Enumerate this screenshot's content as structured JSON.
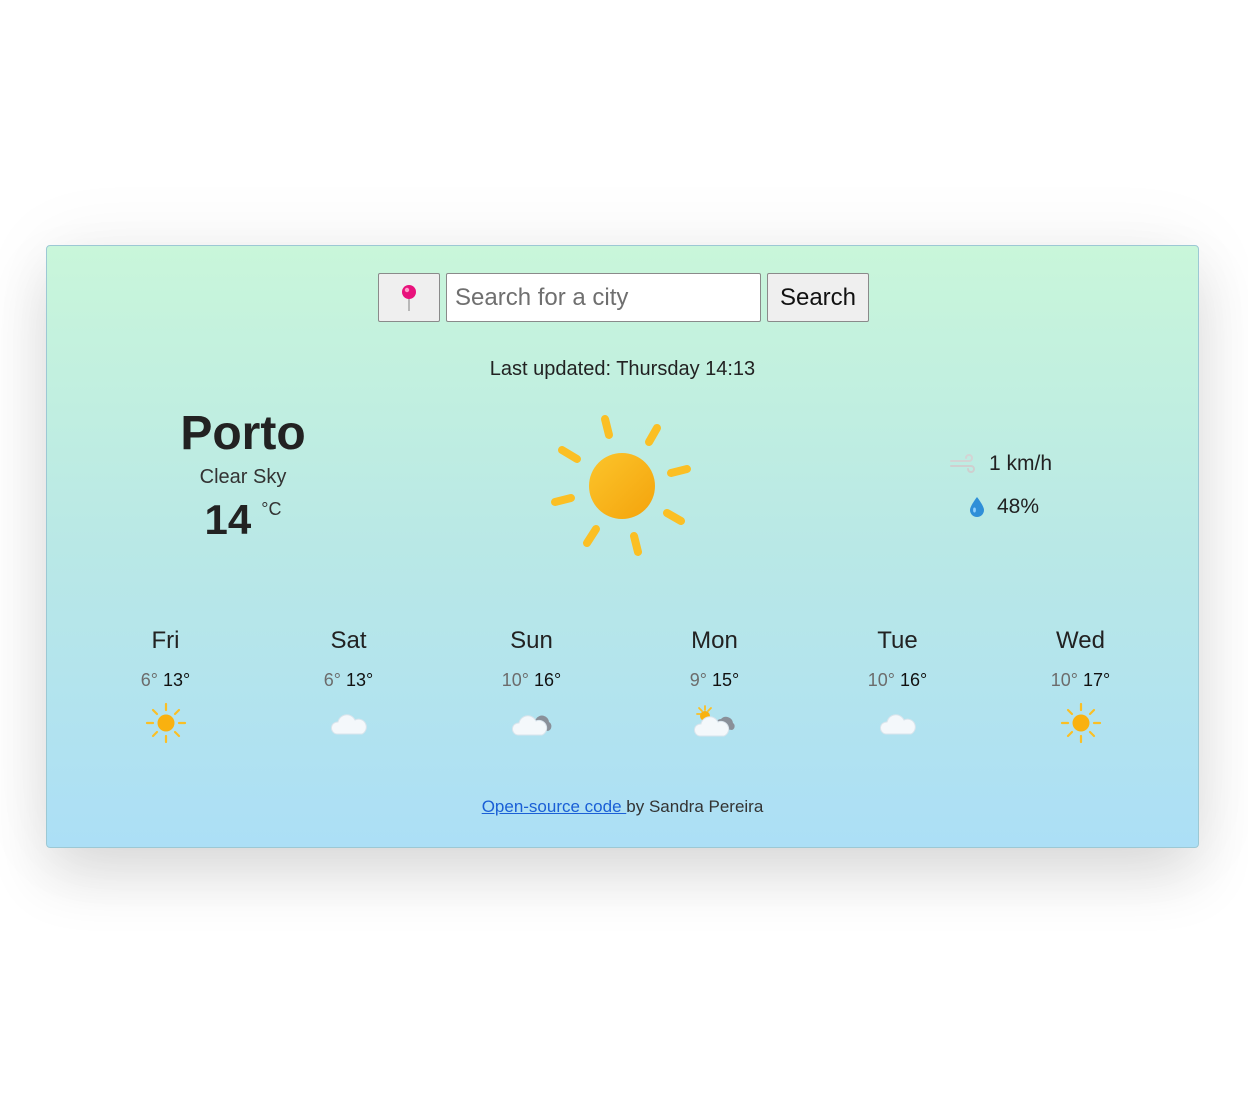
{
  "search": {
    "placeholder": "Search for a city",
    "button_label": "Search",
    "location_icon": "pushpin-icon"
  },
  "current": {
    "last_updated": "Last updated: Thursday 14:13",
    "city": "Porto",
    "condition": "Clear Sky",
    "temperature": "14",
    "unit": "°C",
    "icon": "sun-icon",
    "wind": "1 km/h",
    "wind_icon": "wind-icon",
    "humidity": "48%",
    "humidity_icon": "water-drop-icon"
  },
  "forecast": [
    {
      "day": "Fri",
      "min": "6°",
      "max": "13°",
      "icon": "sun-icon"
    },
    {
      "day": "Sat",
      "min": "6°",
      "max": "13°",
      "icon": "cloud-icon"
    },
    {
      "day": "Sun",
      "min": "10°",
      "max": "16°",
      "icon": "cloudy-icon"
    },
    {
      "day": "Mon",
      "min": "9°",
      "max": "15°",
      "icon": "partly-cloudy-icon"
    },
    {
      "day": "Tue",
      "min": "10°",
      "max": "16°",
      "icon": "cloud-icon"
    },
    {
      "day": "Wed",
      "min": "10°",
      "max": "17°",
      "icon": "sun-icon"
    }
  ],
  "footer": {
    "link_text": "Open-source code ",
    "author_text": "by Sandra Pereira"
  },
  "colors": {
    "gradient_top": "#c9f6da",
    "gradient_bottom": "#acdff6",
    "sun": "#fbbf24",
    "link": "#1a5fd6"
  }
}
